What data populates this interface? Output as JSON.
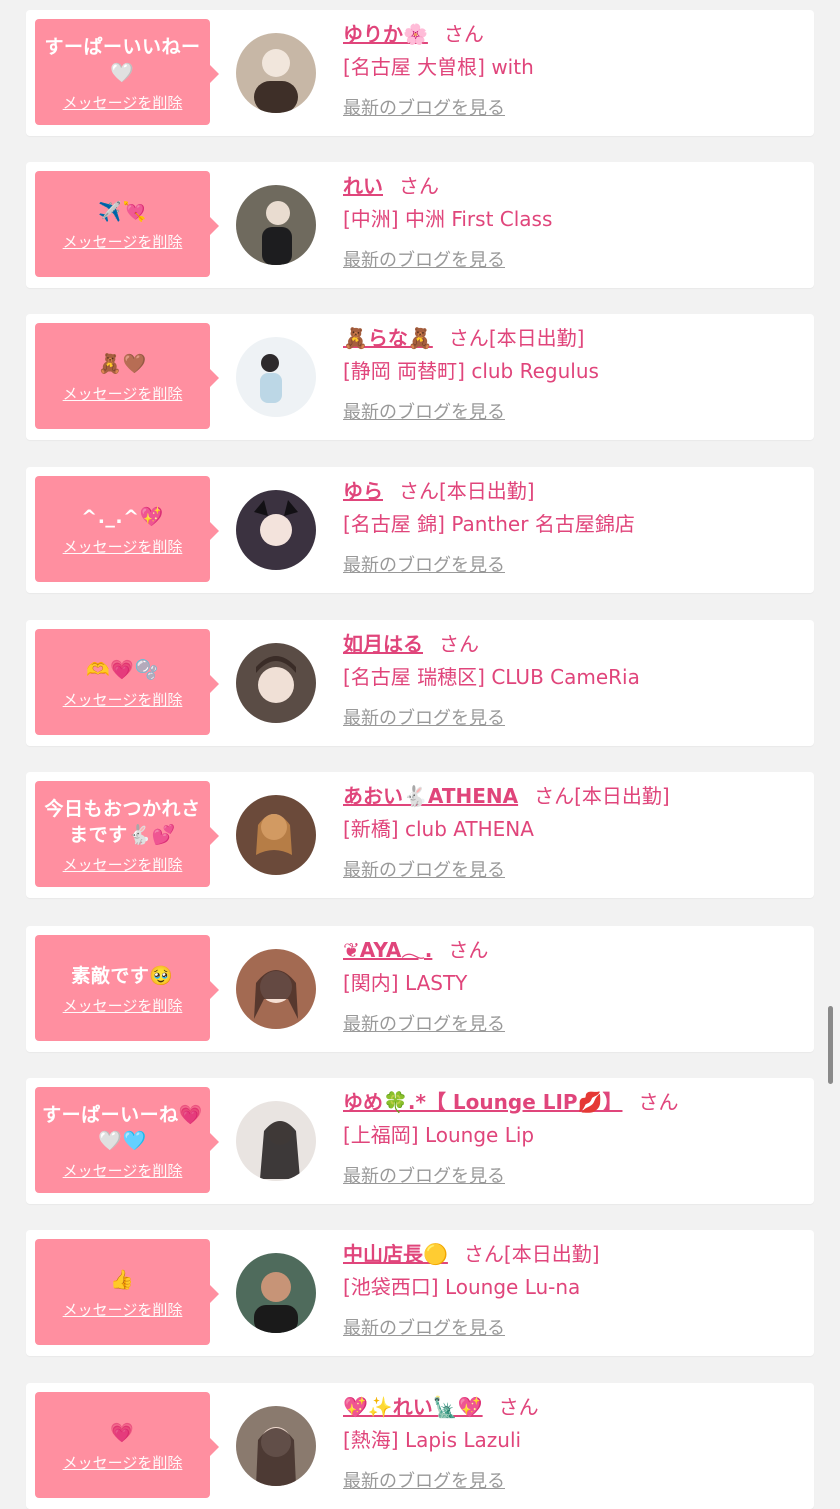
{
  "colors": {
    "bubble": "#ff8fa0",
    "accent": "#e0457b",
    "muted": "#999999",
    "page_bg": "#f2f2f2",
    "card_bg": "#ffffff"
  },
  "items": [
    {
      "message": "すーぱーいいねー🤍",
      "delete_label": "メッセージを削除",
      "name": "ゆりか🌸",
      "honorific": "さん",
      "status": "",
      "shop": "[名古屋 大曽根] with",
      "blog_label": "最新のブログを見る",
      "avatar_color": "#c7b7a6",
      "avatar_icon": "avatar-photo"
    },
    {
      "message": "✈️💘",
      "delete_label": "メッセージを削除",
      "name": "れい",
      "honorific": "さん",
      "status": "",
      "shop": "[中洲] 中洲 First Class",
      "blog_label": "最新のブログを見る",
      "avatar_color": "#6f6a5e",
      "avatar_icon": "avatar-photo"
    },
    {
      "message": "🧸🤎",
      "delete_label": "メッセージを削除",
      "name": "🧸らな🧸",
      "honorific": "さん",
      "status": "[本日出勤]",
      "shop": "[静岡 両替町] club Regulus",
      "blog_label": "最新のブログを見る",
      "avatar_color": "#dfe6ec",
      "avatar_icon": "avatar-photo"
    },
    {
      "message": "^._.^💖",
      "delete_label": "メッセージを削除",
      "name": "ゆら",
      "honorific": "さん",
      "status": "[本日出勤]",
      "shop": "[名古屋 錦] Panther 名古屋錦店",
      "blog_label": "最新のブログを見る",
      "avatar_color": "#3b3240",
      "avatar_icon": "avatar-photo"
    },
    {
      "message": "🫶💗🫧",
      "delete_label": "メッセージを削除",
      "name": "如月はる",
      "honorific": "さん",
      "status": "",
      "shop": "[名古屋 瑞穂区] CLUB CameRia",
      "blog_label": "最新のブログを見る",
      "avatar_color": "#5a4c45",
      "avatar_icon": "avatar-photo"
    },
    {
      "message": "今日もおつかれさまです🐇💕",
      "delete_label": "メッセージを削除",
      "name": "あおい🐇ATHENA",
      "honorific": "さん",
      "status": "[本日出勤]",
      "shop": "[新橋] club ATHENA",
      "blog_label": "最新のブログを見る",
      "avatar_color": "#6b4a3a",
      "avatar_icon": "avatar-photo"
    },
    {
      "message": "素敵です🥹",
      "delete_label": "メッセージを削除",
      "name": "❦AYA𓂃.",
      "honorific": "さん",
      "status": "",
      "shop": "[関内] LASTY",
      "blog_label": "最新のブログを見る",
      "avatar_color": "#a36a52",
      "avatar_icon": "avatar-photo"
    },
    {
      "message": "すーぱーいーね💗🤍🩵",
      "delete_label": "メッセージを削除",
      "name": "ゆめ🍀.*【 Lounge LIP💋】",
      "honorific": "さん",
      "status": "",
      "shop": "[上福岡] Lounge Lip",
      "blog_label": "最新のブログを見る",
      "avatar_color": "#e9e4e1",
      "avatar_icon": "avatar-photo"
    },
    {
      "message": "👍",
      "delete_label": "メッセージを削除",
      "name": "中山店長🟡",
      "honorific": "さん",
      "status": "[本日出勤]",
      "shop": "[池袋西口] Lounge Lu-na",
      "blog_label": "最新のブログを見る",
      "avatar_color": "#4f6b5c",
      "avatar_icon": "avatar-photo"
    },
    {
      "message": "💗",
      "delete_label": "メッセージを削除",
      "name": "💖✨れい🗽💖",
      "honorific": "さん",
      "status": "",
      "shop": "[熱海] Lapis Lazuli",
      "blog_label": "最新のブログを見る",
      "avatar_color": "#8a7a6e",
      "avatar_icon": "avatar-photo"
    }
  ]
}
